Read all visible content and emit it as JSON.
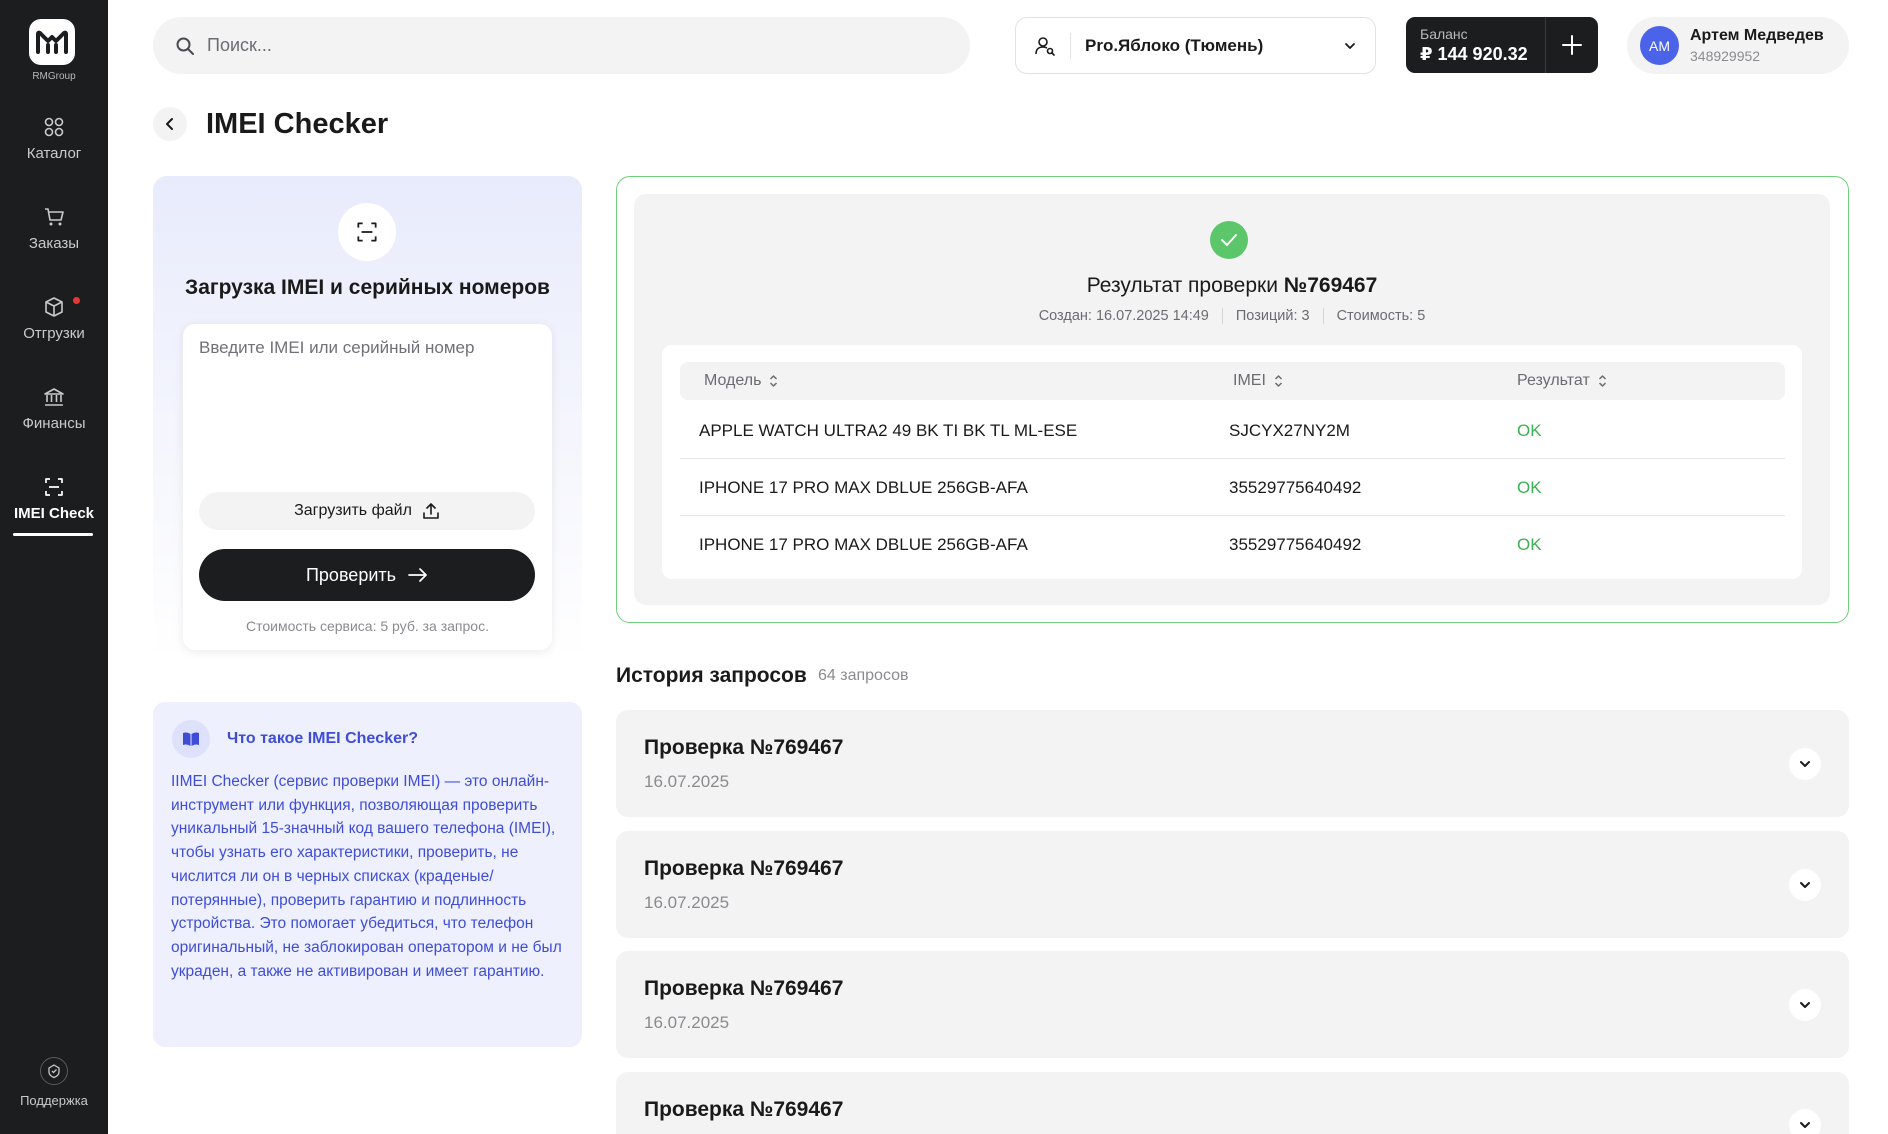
{
  "brand": {
    "name": "RMGroup"
  },
  "sidebar": {
    "items": [
      {
        "label": "Каталог",
        "icon": "grid-icon"
      },
      {
        "label": "Заказы",
        "icon": "cart-icon"
      },
      {
        "label": "Отгрузки",
        "icon": "box-icon",
        "has_notification": true
      },
      {
        "label": "Финансы",
        "icon": "bank-icon"
      },
      {
        "label": "IMEI Check",
        "icon": "scan-icon",
        "active": true
      }
    ],
    "support_label": "Поддержка"
  },
  "header": {
    "search_placeholder": "Поиск...",
    "store": "Pro.Яблоко (Тюмень)",
    "balance_label": "Баланс",
    "balance_value": "₽ 144 920.32",
    "user_initials": "АМ",
    "user_name": "Артем Медведев",
    "user_id": "348929952"
  },
  "page": {
    "title": "IMEI Checker"
  },
  "upload": {
    "title": "Загрузка IMEI и серийных номеров",
    "input_placeholder": "Введите IMEI или серийный номер",
    "input_value": "",
    "file_button": "Загрузить файл",
    "check_button": "Проверить",
    "service_cost": "Стоимость сервиса: 5 руб. за запрос."
  },
  "info": {
    "title": "Что такое IMEI Checker?",
    "text": "IIMEI Checker (сервис проверки IMEI) — это онлайн-инструмент или функция, позволяющая проверить уникальный 15-значный код вашего телефона (IMEI), чтобы узнать его характеристики, проверить, не числится ли он в черных списках (краденые/потерянные), проверить гарантию и подлинность устройства. Это помогает убедиться, что телефон оригинальный, не заблокирован оператором и не был украден, а также не активирован и имеет гарантию."
  },
  "result": {
    "title_prefix": "Результат проверки ",
    "number": "№769467",
    "created": "Создан: 16.07.2025 14:49",
    "positions": "Позиций: 3",
    "cost": "Стоимость: 5",
    "columns": [
      "Модель",
      "IMEI",
      "Результат"
    ],
    "rows": [
      {
        "model": "APPLE WATCH ULTRA2 49 BK TI BK TL ML-ESE",
        "imei": "SJCYX27NY2M",
        "result": "OK"
      },
      {
        "model": "IPHONE 17 PRO MAX DBLUE 256GB-AFA",
        "imei": "35529775640492",
        "result": "OK"
      },
      {
        "model": "IPHONE 17 PRO MAX DBLUE 256GB-AFA",
        "imei": "35529775640492",
        "result": "OK"
      }
    ],
    "colors": {
      "success": "#3cb054",
      "border": "#6fcf7a"
    }
  },
  "history": {
    "title": "История запросов",
    "count": "64 запросов",
    "items": [
      {
        "title": "Проверка №769467",
        "date": "16.07.2025"
      },
      {
        "title": "Проверка №769467",
        "date": "16.07.2025"
      },
      {
        "title": "Проверка №769467",
        "date": "16.07.2025"
      },
      {
        "title": "Проверка №769467",
        "date": ""
      }
    ]
  }
}
